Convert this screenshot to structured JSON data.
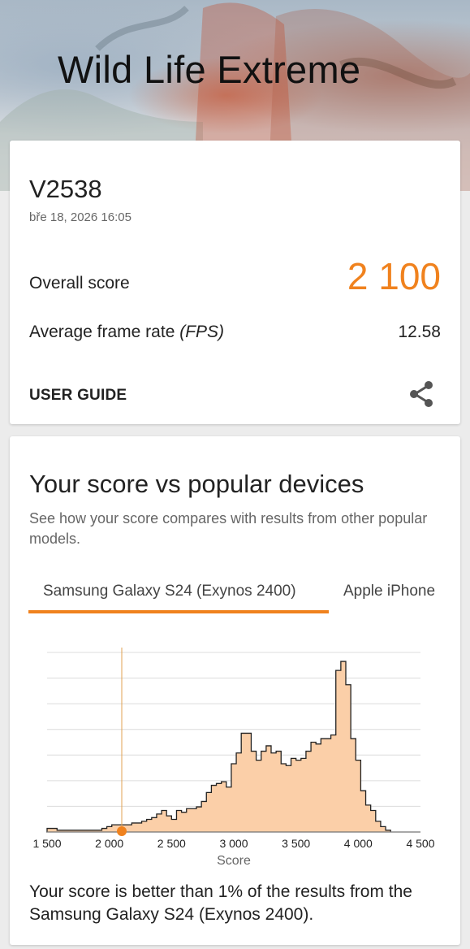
{
  "header": {
    "title": "Wild Life Extreme"
  },
  "result_card": {
    "device": "V2538",
    "datetime": "bře 18, 2026 16:05",
    "overall_label": "Overall score",
    "overall_value": "2 100",
    "fps_label_main": "Average frame rate",
    "fps_label_unit": "(FPS)",
    "fps_value": "12.58",
    "user_guide": "USER GUIDE",
    "share_icon": "share-icon"
  },
  "comparison": {
    "title": "Your score vs popular devices",
    "description": "See how your score compares with results from other popular models.",
    "tabs": [
      {
        "label": "Samsung Galaxy S24 (Exynos 2400)",
        "active": true
      },
      {
        "label": "Apple iPhone",
        "active": false
      }
    ],
    "result_text": "Your score is better than 1% of the results from the Samsung Galaxy S24 (Exynos 2400).",
    "accent_color": "#f0821e",
    "fill_color": "#fbcfa8"
  },
  "chart_data": {
    "type": "area",
    "xlabel": "Score",
    "x_ticks": [
      1500,
      2000,
      2500,
      3000,
      3500,
      4000,
      4500
    ],
    "x_tick_labels": [
      "1 500",
      "2 000",
      "2 500",
      "3 000",
      "3 500",
      "4 000",
      "4 500"
    ],
    "xlim": [
      1500,
      4500
    ],
    "ylim": [
      0,
      100
    ],
    "grid": true,
    "user_score": 2100,
    "bin_width": 40,
    "x": [
      1500,
      1540,
      1580,
      1620,
      1660,
      1700,
      1740,
      1780,
      1820,
      1860,
      1900,
      1940,
      1980,
      2020,
      2060,
      2100,
      2140,
      2180,
      2220,
      2260,
      2300,
      2340,
      2380,
      2420,
      2460,
      2500,
      2540,
      2580,
      2620,
      2660,
      2700,
      2740,
      2780,
      2820,
      2860,
      2900,
      2940,
      2980,
      3020,
      3060,
      3100,
      3140,
      3180,
      3220,
      3260,
      3300,
      3340,
      3380,
      3420,
      3460,
      3500,
      3540,
      3580,
      3620,
      3660,
      3700,
      3740,
      3780,
      3820,
      3860,
      3900,
      3940,
      3980,
      4020,
      4060,
      4100,
      4140,
      4180,
      4220,
      4260,
      4300,
      4340,
      4380,
      4420,
      4460
    ],
    "y": [
      2,
      2,
      1,
      1,
      1,
      1,
      1,
      1,
      1,
      1,
      1,
      2,
      3,
      4,
      4,
      4,
      4,
      5,
      5,
      6,
      7,
      8,
      10,
      12,
      9,
      7,
      12,
      11,
      13,
      13,
      14,
      17,
      22,
      26,
      27,
      28,
      25,
      38,
      44,
      55,
      55,
      45,
      40,
      45,
      48,
      44,
      45,
      38,
      37,
      41,
      40,
      41,
      45,
      50,
      49,
      52,
      52,
      54,
      90,
      95,
      82,
      52,
      40,
      23,
      15,
      12,
      6,
      3,
      1,
      0,
      0,
      0,
      0,
      0,
      0
    ]
  }
}
